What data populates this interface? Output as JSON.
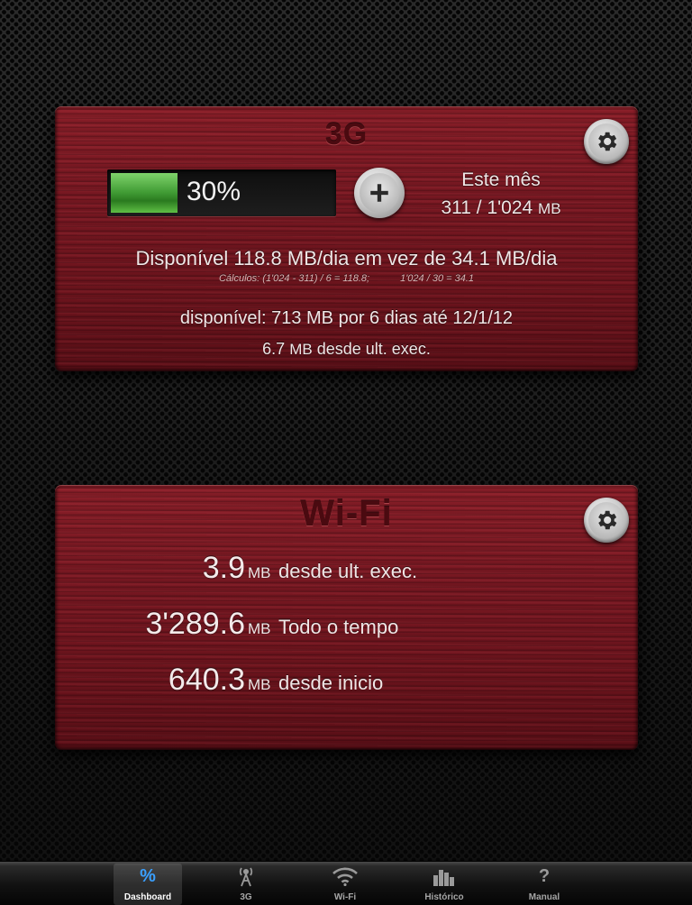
{
  "panel_3g": {
    "title": "3G",
    "usage_percent_label": "30%",
    "usage_fraction": 0.3,
    "month_label": "Este mês",
    "month_used": "311 / 1'024",
    "month_unit": "MB",
    "available_line": "Disponível 118.8 MB/dia em vez de 34.1 MB/dia",
    "calc_left": "Cálculos: (1'024 - 311) / 6 = 118.8;",
    "calc_right": "1'024 / 30 = 34.1",
    "remaining_line": "disponível: 713 MB por 6 dias até 12/1/12",
    "last_exec_value": "6.7",
    "last_exec_unit": "MB",
    "last_exec_label": "desde ult. exec."
  },
  "panel_wifi": {
    "title": "Wi-Fi",
    "rows": [
      {
        "value": "3.9",
        "unit": "MB",
        "label": "desde ult. exec."
      },
      {
        "value": "3'289.6",
        "unit": "MB",
        "label": "Todo o tempo"
      },
      {
        "value": "640.3",
        "unit": "MB",
        "label": "desde inicio"
      }
    ]
  },
  "tabbar": {
    "tabs": [
      {
        "label": "Dashboard",
        "icon": "percent-icon",
        "active": true
      },
      {
        "label": "3G",
        "icon": "antenna-icon",
        "active": false
      },
      {
        "label": "Wi-Fi",
        "icon": "wifi-icon",
        "active": false
      },
      {
        "label": "Histórico",
        "icon": "bar-chart-icon",
        "active": false
      },
      {
        "label": "Manual",
        "icon": "question-icon",
        "active": false
      }
    ]
  },
  "colors": {
    "wood": "#7a1822",
    "engraved_text": "#4a0a10",
    "progress_green": "#3f9a33",
    "tab_active": "#3aa0ff"
  }
}
